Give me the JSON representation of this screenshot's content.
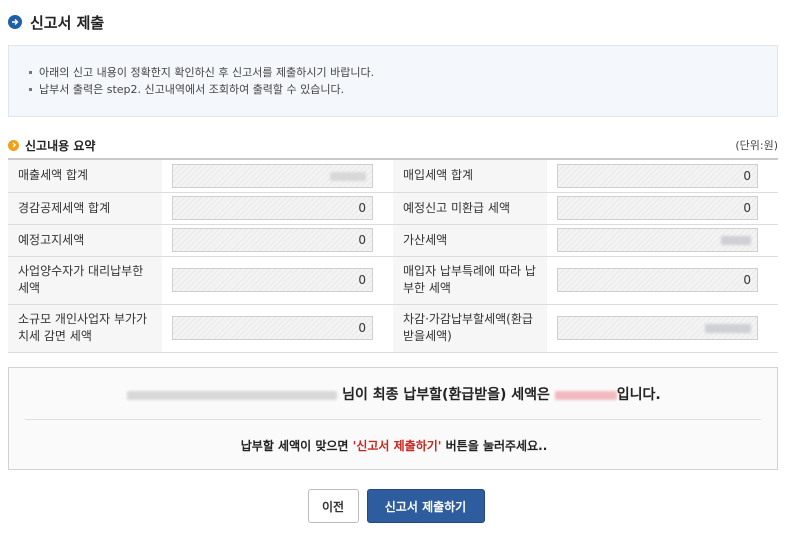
{
  "page": {
    "title": "신고서 제출"
  },
  "notice": {
    "lines": [
      "아래의 신고 내용이 정확한지 확인하신 후 신고서를 제출하시기 바랍니다.",
      "납부서 출력은 step2. 신고내역에서 조회하여 출력할 수 있습니다."
    ]
  },
  "summary": {
    "title": "신고내용 요약",
    "unit": "(단위:원)",
    "rows": [
      {
        "l1": "매출세액 합계",
        "v1": "",
        "l2": "매입세액 합계",
        "v2": "0"
      },
      {
        "l1": "경감공제세액 합계",
        "v1": "0",
        "l2": "예정신고 미환급 세액",
        "v2": "0"
      },
      {
        "l1": "예정고지세액",
        "v1": "0",
        "l2": "가산세액",
        "v2": ""
      },
      {
        "l1": "사업양수자가 대리납부한 세액",
        "v1": "0",
        "l2": "매입자 납부특례에 따라 납부한 세액",
        "v2": "0"
      },
      {
        "l1": "소규모 개인사업자 부가가치세 감면 세액",
        "v1": "0",
        "l2": "차감·가감납부할세액(환급받을세액)",
        "v2": ""
      }
    ]
  },
  "result": {
    "mid_text": "님이 최종 납부할(환급받을) 세액은",
    "end_text": "입니다.",
    "sub_prefix": "납부할 세액이 맞으면",
    "sub_highlight": "'신고서 제출하기'",
    "sub_suffix": "버튼을 눌러주세요.."
  },
  "buttons": {
    "prev": "이전",
    "submit": "신고서 제출하기"
  },
  "colors": {
    "accent": "#2d5d9f",
    "highlight": "#c8261e",
    "section_icon": "#f0a11c",
    "title_icon": "#1f5fa6"
  }
}
